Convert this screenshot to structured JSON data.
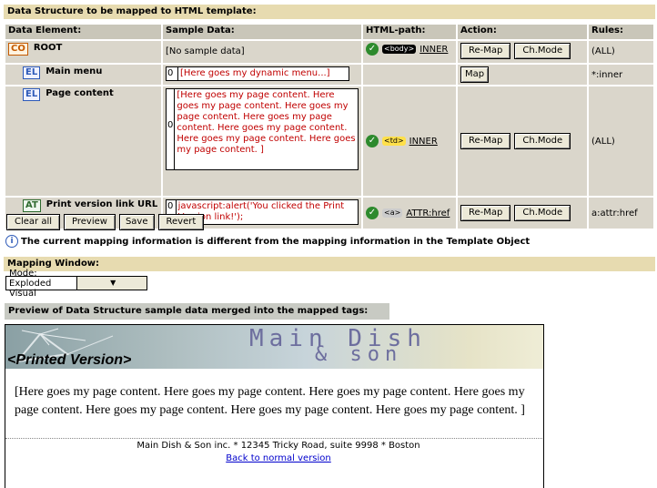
{
  "header": "Data Structure to be mapped to HTML template:",
  "columns": [
    "Data Element:",
    "Sample Data:",
    "HTML-path:",
    "Action:",
    "Rules:"
  ],
  "rows": [
    {
      "badge": "CO",
      "name": "ROOT",
      "sample_text": "[No sample data]",
      "path_tag": "<body>",
      "path_link": "INNER",
      "actions": [
        "Re-Map",
        "Ch.Mode"
      ],
      "rules": "(ALL)"
    },
    {
      "badge": "EL",
      "name": "Main menu",
      "sample_num": "0",
      "sample_text": "[Here goes my dynamic menu...]",
      "actions": [
        "Map"
      ],
      "rules": "*:inner"
    },
    {
      "badge": "EL",
      "name": "Page content",
      "sample_num": "0",
      "sample_text": "[Here goes my page content. Here goes my page content. Here goes my page content. Here goes my page content. Here goes my page content. Here goes my page content. Here goes my page content. ]",
      "path_tag": "<td>",
      "path_link": "INNER",
      "actions": [
        "Re-Map",
        "Ch.Mode"
      ],
      "rules": "(ALL)"
    },
    {
      "badge": "AT",
      "name": "Print version link URL",
      "sample_num": "0",
      "sample_text": "javascript:alert('You clicked the Print Version link!');",
      "path_tag": "<a>",
      "path_link": "ATTR:href",
      "actions": [
        "Re-Map",
        "Ch.Mode"
      ],
      "rules": "a:attr:href"
    }
  ],
  "buttons": {
    "clear": "Clear all",
    "preview": "Preview",
    "save": "Save",
    "revert": "Revert"
  },
  "info_message": "The current mapping information is different from the mapping information in the Template Object",
  "mapping_window": {
    "title": "Mapping Window:",
    "mode_value": "Mode: Exploded Visual"
  },
  "preview_title": "Preview of Data Structure sample data merged into the mapped tags:",
  "preview": {
    "brand_line1": "Main Dish",
    "brand_line2": "& son",
    "printed_version": "<Printed Version>",
    "body_text": "[Here goes my page content. Here goes my page content. Here goes my page content. Here goes my page content. Here goes my page content. Here goes my page content. Here goes my page content. ]",
    "footer": "Main Dish & Son inc. * 12345 Tricky Road, suite 9998 * Boston",
    "back_link": "Back to normal version"
  }
}
